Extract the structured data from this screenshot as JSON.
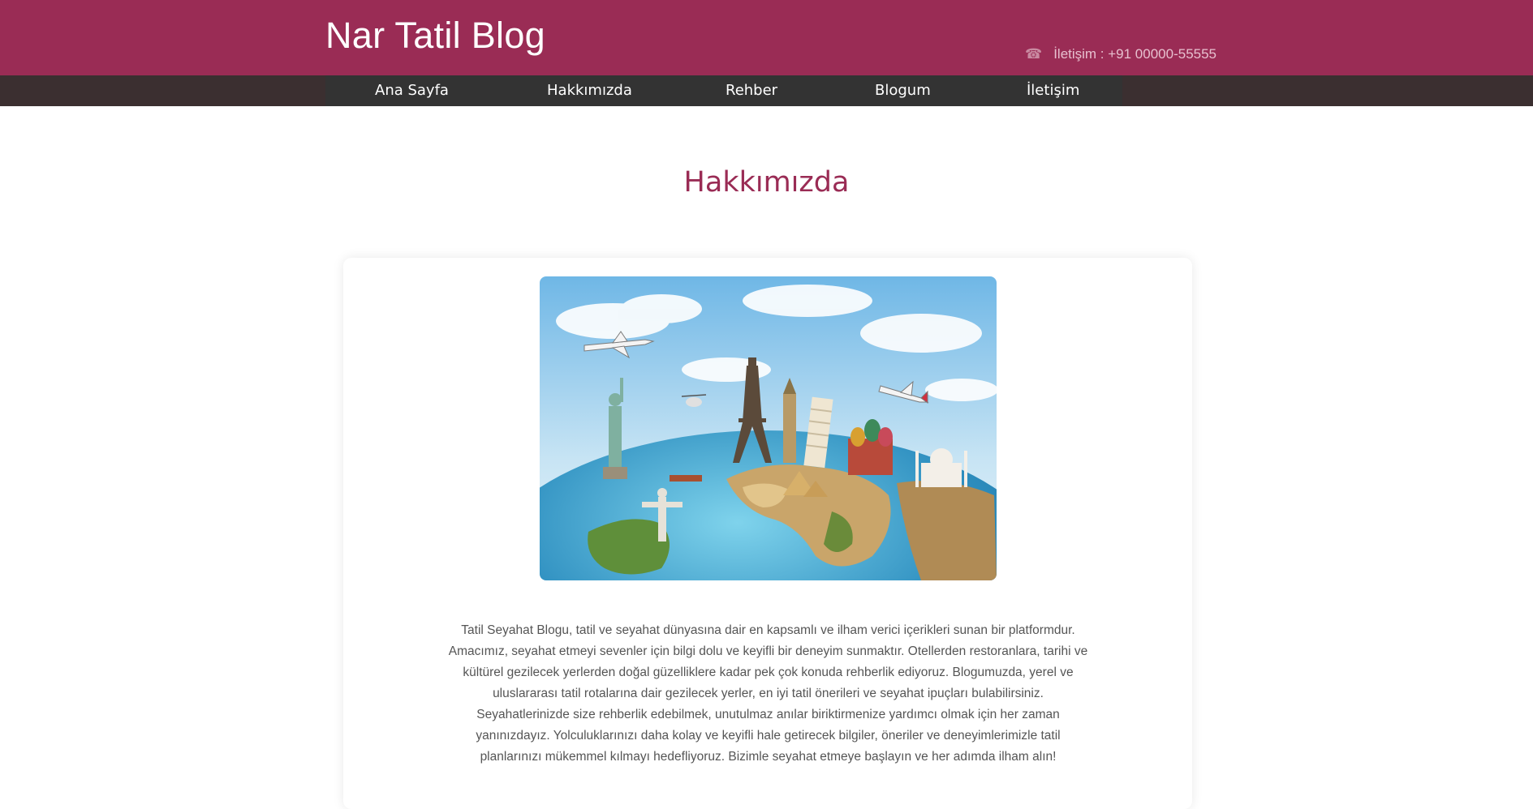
{
  "header": {
    "brand": "Nar Tatil Blog",
    "contact_icon": "phone-icon",
    "contact_text": "İletişim : +91 00000-55555"
  },
  "nav": {
    "items": [
      {
        "label": "Ana Sayfa"
      },
      {
        "label": "Hakkımızda"
      },
      {
        "label": "Rehber"
      },
      {
        "label": "Blogum"
      },
      {
        "label": "İletişim"
      }
    ]
  },
  "main": {
    "title": "Hakkımızda",
    "description": "Tatil Seyahat Blogu, tatil ve seyahat dünyasına dair en kapsamlı ve ilham verici içerikleri sunan bir platformdur. Amacımız, seyahat etmeyi sevenler için bilgi dolu ve keyifli bir deneyim sunmaktır. Otellerden restoranlara, tarihi ve kültürel gezilecek yerlerden doğal güzelliklere kadar pek çok konuda rehberlik ediyoruz. Blogumuzda, yerel ve uluslararası tatil rotalarına dair gezilecek yerler, en iyi tatil önerileri ve seyahat ipuçları bulabilirsiniz. Seyahatlerinizde size rehberlik edebilmek, unutulmaz anılar biriktirmenize yardımcı olmak için her zaman yanınızdayız. Yolculuklarınızı daha kolay ve keyifli hale getirecek bilgiler, öneriler ve deneyimlerimizle tatil planlarınızı mükemmel kılmayı hedefliyoruz. Bizimle seyahat etmeye başlayın ve her adımda ilham alın!"
  },
  "colors": {
    "brand": "#9a2c55",
    "nav_bg": "#333333",
    "nav_band": "#3b2f30",
    "text": "#555555"
  }
}
